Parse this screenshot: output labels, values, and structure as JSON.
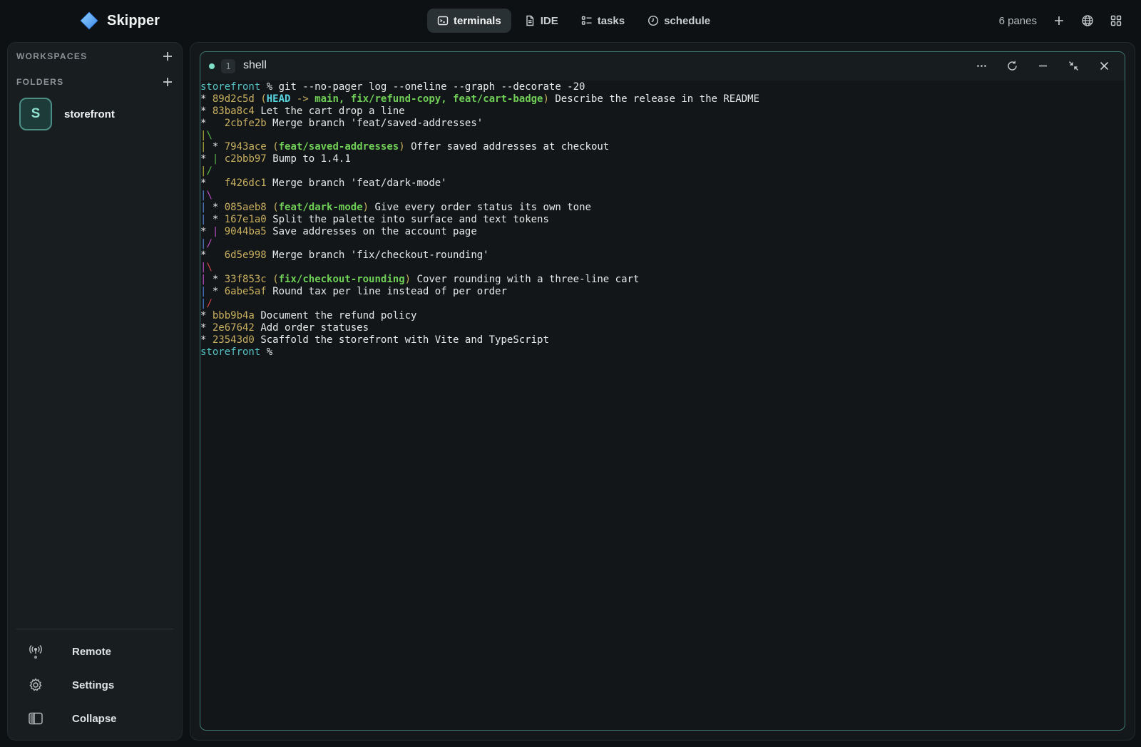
{
  "app": {
    "name": "Skipper"
  },
  "nav": {
    "tabs": [
      {
        "label": "terminals",
        "icon": "terminal-icon",
        "active": true
      },
      {
        "label": "IDE",
        "icon": "file-icon",
        "active": false
      },
      {
        "label": "tasks",
        "icon": "tasks-icon",
        "active": false
      },
      {
        "label": "schedule",
        "icon": "clock-icon",
        "active": false
      }
    ]
  },
  "topbar": {
    "panes_count": "6 panes"
  },
  "sidebar": {
    "workspaces_label": "WORKSPACES",
    "folders_label": "FOLDERS",
    "folders": [
      {
        "initial": "S",
        "name": "storefront"
      }
    ],
    "footer": [
      {
        "label": "Remote",
        "icon": "antenna-icon"
      },
      {
        "label": "Settings",
        "icon": "gear-icon"
      },
      {
        "label": "Collapse",
        "icon": "sidebar-toggle-icon"
      }
    ]
  },
  "pane": {
    "number": "1",
    "title": "shell"
  },
  "terminal": {
    "prompt": "storefront",
    "command": "git --no-pager log --oneline --graph --decorate -20",
    "head_label": "HEAD",
    "head_branches": "main, fix/refund-copy, feat/cart-badge",
    "commits": [
      {
        "hash": "89d2c5d",
        "ref": "",
        "message": "Describe the release in the README"
      },
      {
        "hash": "83ba8c4",
        "ref": "",
        "message": "Let the cart drop a line"
      },
      {
        "hash": "2cbfe2b",
        "ref": "",
        "message": "Merge branch 'feat/saved-addresses'"
      },
      {
        "hash": "7943ace",
        "ref": "feat/saved-addresses",
        "message": "Offer saved addresses at checkout"
      },
      {
        "hash": "c2bbb97",
        "ref": "",
        "message": "Bump to 1.4.1"
      },
      {
        "hash": "f426dc1",
        "ref": "",
        "message": "Merge branch 'feat/dark-mode'"
      },
      {
        "hash": "085aeb8",
        "ref": "feat/dark-mode",
        "message": "Give every order status its own tone"
      },
      {
        "hash": "167e1a0",
        "ref": "",
        "message": "Split the palette into surface and text tokens"
      },
      {
        "hash": "9044ba5",
        "ref": "",
        "message": "Save addresses on the account page"
      },
      {
        "hash": "6d5e998",
        "ref": "",
        "message": "Merge branch 'fix/checkout-rounding'"
      },
      {
        "hash": "33f853c",
        "ref": "fix/checkout-rounding",
        "message": "Cover rounding with a three-line cart"
      },
      {
        "hash": "6abe5af",
        "ref": "",
        "message": "Round tax per line instead of per order"
      },
      {
        "hash": "bbb9b4a",
        "ref": "",
        "message": "Document the refund policy"
      },
      {
        "hash": "2e67642",
        "ref": "",
        "message": "Add order statuses"
      },
      {
        "hash": "23543d0",
        "ref": "",
        "message": "Scaffold the storefront with Vite and TypeScript"
      }
    ]
  }
}
